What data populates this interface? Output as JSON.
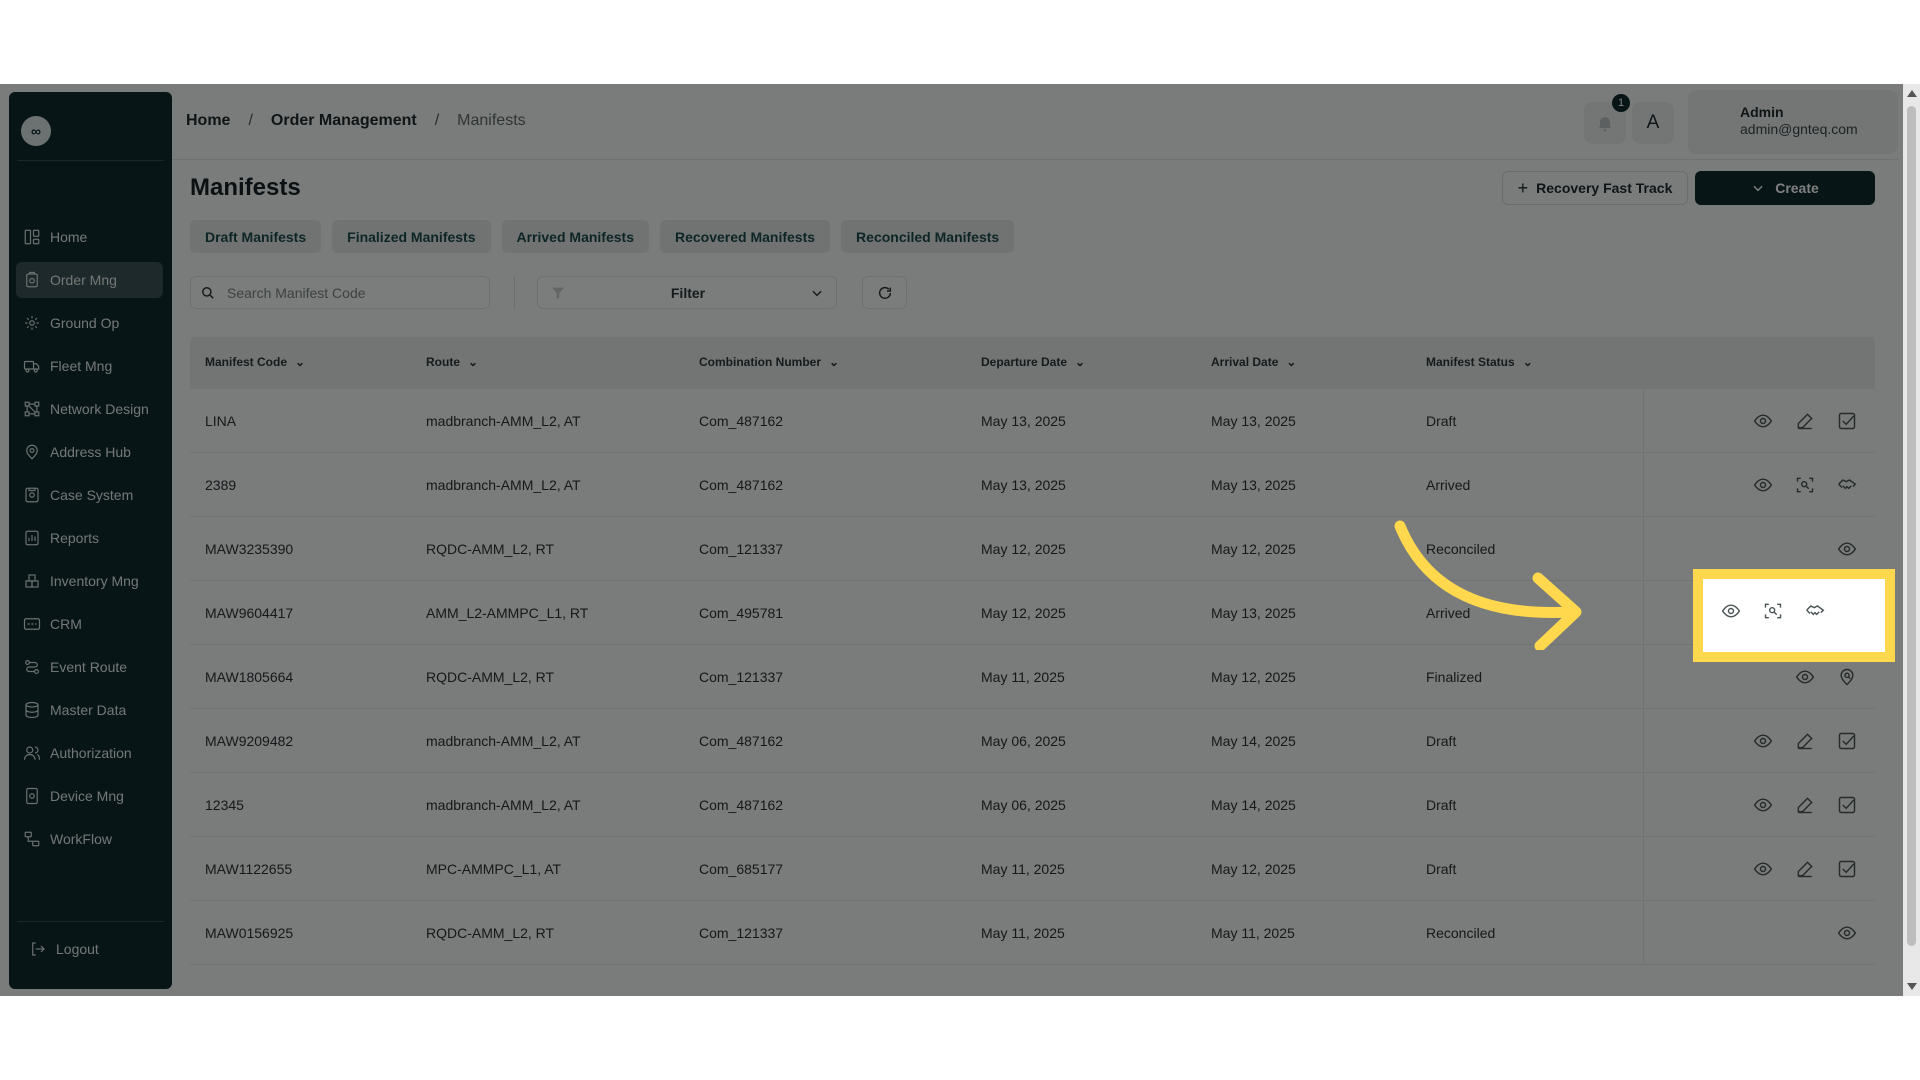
{
  "sidebar": {
    "items": [
      {
        "label": "Home",
        "icon": "layout-grid-icon"
      },
      {
        "label": "Order Mng",
        "icon": "clipboard-gear-icon"
      },
      {
        "label": "Ground Op",
        "icon": "radar-gear-icon"
      },
      {
        "label": "Fleet Mng",
        "icon": "truck-icon"
      },
      {
        "label": "Network Design",
        "icon": "network-icon"
      },
      {
        "label": "Address Hub",
        "icon": "map-pin-gear-icon"
      },
      {
        "label": "Case System",
        "icon": "case-icon"
      },
      {
        "label": "Reports",
        "icon": "report-icon"
      },
      {
        "label": "Inventory Mng",
        "icon": "inventory-icon"
      },
      {
        "label": "CRM",
        "icon": "crm-icon"
      },
      {
        "label": "Event Route",
        "icon": "route-icon"
      },
      {
        "label": "Master Data",
        "icon": "database-icon"
      },
      {
        "label": "Authorization",
        "icon": "users-icon"
      },
      {
        "label": "Device Mng",
        "icon": "device-gear-icon"
      },
      {
        "label": "WorkFlow",
        "icon": "workflow-icon"
      }
    ],
    "active": "Order Mng",
    "logout_label": "Logout"
  },
  "header": {
    "breadcrumb": [
      "Home",
      "Order Management",
      "Manifests"
    ],
    "notification_count": "1",
    "language_label": "A",
    "user_name": "Admin",
    "user_email": "admin@gnteq.com"
  },
  "page": {
    "title": "Manifests",
    "recovery_label": "Recovery Fast Track",
    "create_label": "Create",
    "tabs": [
      "Draft Manifests",
      "Finalized Manifests",
      "Arrived Manifests",
      "Recovered Manifests",
      "Reconciled Manifests"
    ],
    "search_placeholder": "Search Manifest Code",
    "filter_label": "Filter"
  },
  "table": {
    "columns": [
      "Manifest Code",
      "Route",
      "Combination Number",
      "Departure Date",
      "Arrival Date",
      "Manifest Status"
    ],
    "rows": [
      {
        "code": "LINA",
        "route": "madbranch-AMM_L2, AT",
        "combo": "Com_487162",
        "departure": "May 13, 2025",
        "arrival": "May 13, 2025",
        "status": "Draft"
      },
      {
        "code": "2389",
        "route": "madbranch-AMM_L2, AT",
        "combo": "Com_487162",
        "departure": "May 13, 2025",
        "arrival": "May 13, 2025",
        "status": "Arrived"
      },
      {
        "code": "MAW3235390",
        "route": "RQDC-AMM_L2, RT",
        "combo": "Com_121337",
        "departure": "May 12, 2025",
        "arrival": "May 12, 2025",
        "status": "Reconciled"
      },
      {
        "code": "MAW9604417",
        "route": "AMM_L2-AMMPC_L1, RT",
        "combo": "Com_495781",
        "departure": "May 12, 2025",
        "arrival": "May 13, 2025",
        "status": "Arrived"
      },
      {
        "code": "MAW1805664",
        "route": "RQDC-AMM_L2, RT",
        "combo": "Com_121337",
        "departure": "May 11, 2025",
        "arrival": "May 12, 2025",
        "status": "Finalized"
      },
      {
        "code": "MAW9209482",
        "route": "madbranch-AMM_L2, AT",
        "combo": "Com_487162",
        "departure": "May 06, 2025",
        "arrival": "May 14, 2025",
        "status": "Draft"
      },
      {
        "code": "12345",
        "route": "madbranch-AMM_L2, AT",
        "combo": "Com_487162",
        "departure": "May 06, 2025",
        "arrival": "May 14, 2025",
        "status": "Draft"
      },
      {
        "code": "MAW1122655",
        "route": "MPC-AMMPC_L1, AT",
        "combo": "Com_685177",
        "departure": "May 11, 2025",
        "arrival": "May 12, 2025",
        "status": "Draft"
      },
      {
        "code": "MAW0156925",
        "route": "RQDC-AMM_L2, RT",
        "combo": "Com_121337",
        "departure": "May 11, 2025",
        "arrival": "May 11, 2025",
        "status": "Reconciled"
      }
    ],
    "action_sets": {
      "Draft": [
        "eye-icon",
        "pencil-icon",
        "checkbox-icon"
      ],
      "Arrived": [
        "eye-icon",
        "scan-icon",
        "handshake-icon"
      ],
      "Reconciled": [
        "eye-icon"
      ],
      "Finalized": [
        "eye-icon",
        "location-search-icon"
      ]
    }
  },
  "highlight": {
    "color": "#ffd84d",
    "row_code": "MAW9604417"
  }
}
